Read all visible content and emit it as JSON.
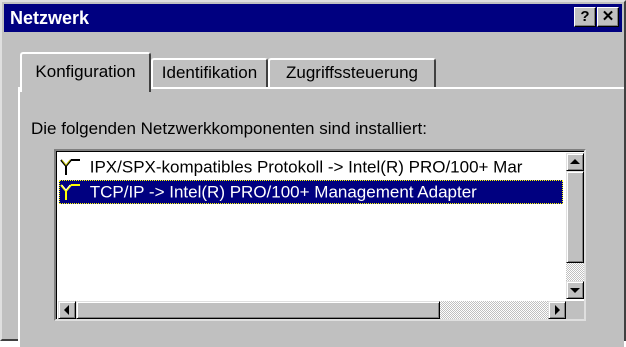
{
  "window": {
    "title": "Netzwerk",
    "help_label": "?",
    "close_label": "✕"
  },
  "tabs": [
    {
      "label": "Konfiguration",
      "active": true
    },
    {
      "label": "Identifikation",
      "active": false
    },
    {
      "label": "Zugriffssteuerung",
      "active": false
    }
  ],
  "panel": {
    "installed_label": "Die folgenden Netzwerkkomponenten sind installiert:"
  },
  "components": [
    {
      "label": "IPX/SPX-kompatibles Protokoll -> Intel(R) PRO/100+ Mar",
      "icon": "network-protocol-icon",
      "selected": false
    },
    {
      "label": "TCP/IP -> Intel(R) PRO/100+ Management Adapter",
      "icon": "network-protocol-icon",
      "selected": true
    }
  ],
  "colors": {
    "title_bar": "#000080",
    "window_face": "#c0c0c0",
    "selection": "#000080",
    "list_background": "#ffffff"
  }
}
